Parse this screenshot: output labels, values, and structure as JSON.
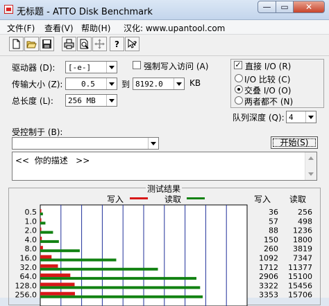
{
  "window": {
    "title": "无标题 - ATTO Disk Benchmark",
    "minimize": "—",
    "maximize": "▭",
    "close": "✕"
  },
  "menu": [
    "文件(F)",
    "查看(V)",
    "帮助(H)",
    "汉化: www.upantool.com"
  ],
  "toolbar": [
    "new-file-icon",
    "open-folder-icon",
    "save-icon",
    "print-icon",
    "print-preview-icon",
    "move-icon",
    "help-icon",
    "context-help-icon"
  ],
  "settings": {
    "drive_label": "驱动器 (D):",
    "drive_value": "[-e-]",
    "force_write_label": "强制写入访问 (A)",
    "force_write_checked": false,
    "transfer_label": "传输大小 (Z):",
    "transfer_from": "0.5",
    "transfer_to_label": "到",
    "transfer_to": "8192.0",
    "transfer_unit": "KB",
    "length_label": "总长度 (L):",
    "length_value": "256 MB",
    "direct_io_label": "直接 I/O (R)",
    "direct_io_checked": true,
    "io_compare_label": "I/O 比较 (C)",
    "overlapped_io_label": "交叠 I/O (O)",
    "neither_label": "两者都不 (N)",
    "io_mode_selected": "overlapped",
    "queue_label": "队列深度 (Q):",
    "queue_value": "4",
    "controlled_label": "受控制于 (B):",
    "controlled_value": "",
    "start_button": "开始(S)",
    "description": "<<  你的描述   >>"
  },
  "results": {
    "title": "测试结果",
    "legend_write": "写入",
    "legend_read": "读取",
    "col_write": "写入",
    "col_read": "读取",
    "write_color": "#d81818",
    "read_color": "#128212"
  },
  "chart_data": {
    "type": "bar",
    "orientation": "horizontal",
    "categories": [
      "0.5",
      "1.0",
      "2.0",
      "4.0",
      "8.0",
      "16.0",
      "32.0",
      "64.0",
      "128.0",
      "256.0"
    ],
    "series": [
      {
        "name": "写入",
        "values": [
          36,
          57,
          88,
          150,
          260,
          1092,
          1712,
          2906,
          3322,
          3353
        ]
      },
      {
        "name": "读取",
        "values": [
          256,
          498,
          1236,
          1800,
          3819,
          7347,
          11377,
          15100,
          15456,
          15706
        ]
      }
    ],
    "xlim": [
      0,
      20000
    ]
  }
}
